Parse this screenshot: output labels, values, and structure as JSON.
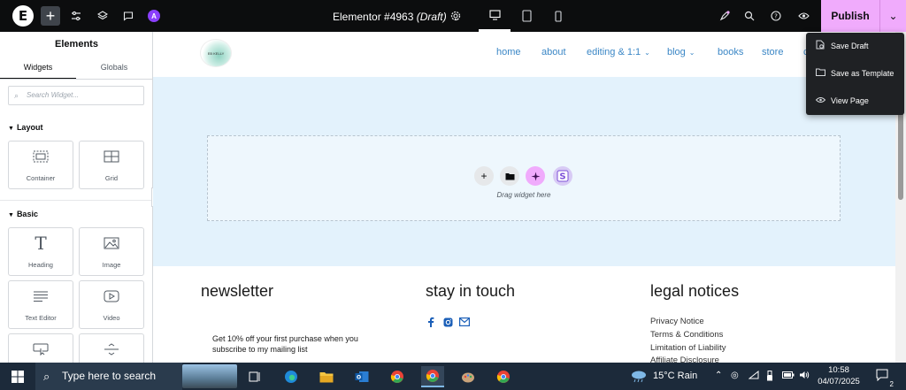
{
  "topbar": {
    "logo": "E",
    "add": "+",
    "doc_title": "Elementor #4963",
    "doc_status": "(Draft)",
    "publish_label": "Publish",
    "ai_badge": "A"
  },
  "dropdown": {
    "items": [
      {
        "label": "Save Draft",
        "icon": "save-draft-icon"
      },
      {
        "label": "Save as Template",
        "icon": "folder-icon"
      },
      {
        "label": "View Page",
        "icon": "eye-icon"
      }
    ]
  },
  "panel": {
    "title": "Elements",
    "tabs": [
      "Widgets",
      "Globals"
    ],
    "search_placeholder": "Search Widget...",
    "categories": [
      {
        "label": "Layout",
        "widgets": [
          "Container",
          "Grid"
        ]
      },
      {
        "label": "Basic",
        "widgets": [
          "Heading",
          "Image",
          "Text Editor",
          "Video"
        ]
      }
    ]
  },
  "canvas": {
    "site_logo": "EB KELLY",
    "nav": [
      "home",
      "about",
      "editing & 1:1",
      "blog",
      "books",
      "store",
      "c"
    ],
    "drop_text": "Drag widget here",
    "footer": {
      "col1_heading": "newsletter",
      "col1_text": "Get 10% off your first purchase when you subscribe to my mailing list",
      "col2_heading": "stay in touch",
      "col3_heading": "legal notices",
      "legal_links": [
        "Privacy Notice",
        "Terms & Conditions",
        "Limitation of Liability",
        "Affiliate Disclosure"
      ]
    }
  },
  "taskbar": {
    "search_placeholder": "Type here to search",
    "weather": "15°C  Rain",
    "time": "10:58",
    "date": "04/07/2025",
    "notifications": "2"
  },
  "colors": {
    "publish_bg": "#f0abfc",
    "nav_link": "#3b87c6",
    "canvas_section": "#e3f2fc",
    "topbar_bg": "#0c0d0e",
    "taskbar_bg": "#1c2a3a"
  }
}
